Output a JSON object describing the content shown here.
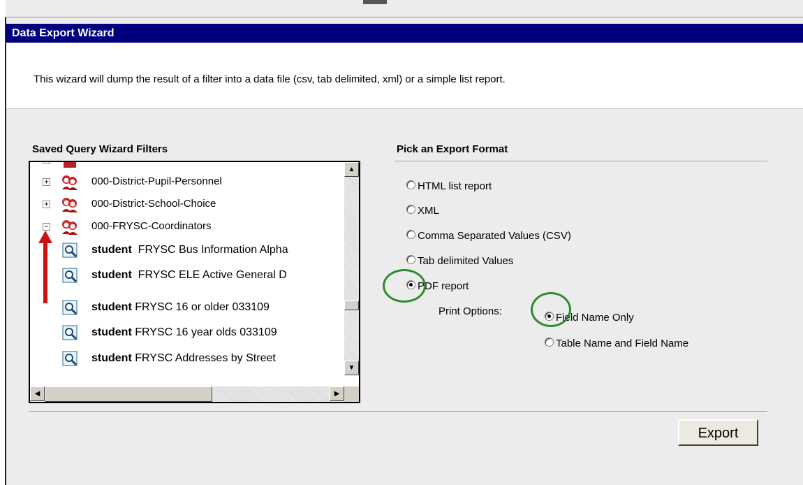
{
  "window": {
    "title": "Data Export Wizard",
    "intro": "This wizard will dump the result of a filter into a data file (csv, tab delimited, xml) or a simple list report."
  },
  "filters": {
    "heading": "Saved Query Wizard Filters",
    "groups": [
      {
        "label": "000-District-Pupil-Personnel",
        "state": "+"
      },
      {
        "label": "000-District-School-Choice",
        "state": "+"
      },
      {
        "label": "000-FRYSC-Coordinators",
        "state": "−"
      }
    ],
    "queries": [
      {
        "type": "student",
        "name": "FRYSC Bus Information Alpha"
      },
      {
        "type": "student",
        "name": "FRYSC ELE Active General D"
      },
      {
        "type": "student",
        "name": "FRYSC 16 or older 033109"
      },
      {
        "type": "student",
        "name": "FRYSC 16 year olds 033109"
      },
      {
        "type": "student",
        "name": "FRYSC Addresses by Street"
      }
    ]
  },
  "format": {
    "heading": "Pick an Export Format",
    "options": [
      {
        "label": "HTML list report",
        "selected": false
      },
      {
        "label": "XML",
        "selected": false
      },
      {
        "label": "Comma Separated Values (CSV)",
        "selected": false
      },
      {
        "label": "Tab delimited Values",
        "selected": false
      },
      {
        "label": "PDF report",
        "selected": true
      }
    ],
    "print_options_label": "Print Options:",
    "print_options": [
      {
        "label": "Field Name Only",
        "selected": true
      },
      {
        "label": "Table Name and Field Name",
        "selected": false
      }
    ]
  },
  "actions": {
    "export_label": "Export"
  },
  "colors": {
    "titlebar": "#000080",
    "annotation": "#2e8b2e",
    "arrow": "#cc1111"
  }
}
